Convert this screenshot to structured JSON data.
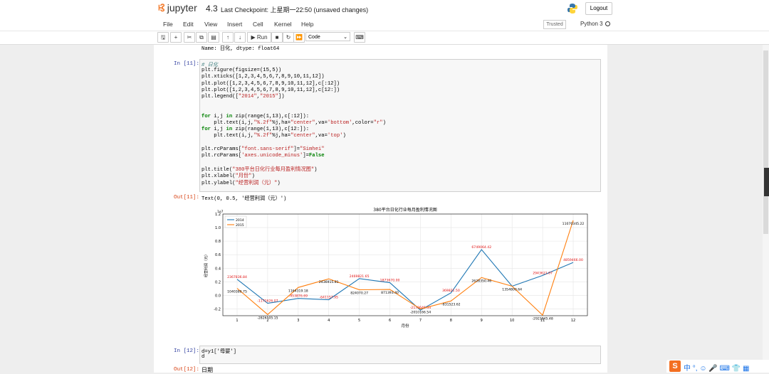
{
  "header": {
    "app_name": "jupyter",
    "notebook_name": "4.3",
    "checkpoint": "Last Checkpoint: 上星期一22:50  (unsaved changes)",
    "logout_label": "Logout"
  },
  "menu": [
    "File",
    "Edit",
    "View",
    "Insert",
    "Cell",
    "Kernel",
    "Help"
  ],
  "trusted_label": "Trusted",
  "kernel_label": "Python 3",
  "toolbar": {
    "run_label": "Run",
    "cell_type": "Code"
  },
  "cells": {
    "prev_output": "Name: 日化, dtype: float64",
    "cell11_prompt": "In [11]:",
    "cell11_lines": [
      "# 日化",
      "plt.figure(figsize=(15,5))",
      "plt.xticks([1,2,3,4,5,6,7,8,9,10,11,12])",
      "plt.plot([1,2,3,4,5,6,7,8,9,10,11,12],c[:12])",
      "plt.plot([1,2,3,4,5,6,7,8,9,10,11,12],c[12:])",
      "plt.legend([\"2014\",\"2015\"])",
      "",
      "",
      "for i,j in zip(range(1,13),c[:12]):",
      "    plt.text(i,j,\"%.2f\"%j,ha=\"center\",va='bottom',color=\"r\")",
      "for i,j in zip(range(1,13),c[12:]):",
      "    plt.text(i,j,\"%.2f\"%j,ha=\"center\",va='top')",
      "",
      "plt.rcParams[\"font.sans-serif\"]=\"Simhei\"",
      "plt.rcParams['axes.unicode_minus']=False",
      "",
      "plt.title(\"380平台日化行业每月盈利情况图\")",
      "plt.xlabel(\"月份\")",
      "plt.ylabel(\"经营利润（元）\")"
    ],
    "out11_prompt": "Out[11]:",
    "out11_text": "Text(0, 0.5, '经营利润（元）')",
    "cell12_prompt": "In [12]:",
    "cell12_lines": [
      "d=y1['母婴']",
      "d"
    ],
    "out12_prompt": "Out[12]:",
    "out12_text": "日期"
  },
  "chart_data": {
    "type": "line",
    "title": "380平台日化行业每月盈利情况图",
    "xlabel": "月份",
    "ylabel": "经营利润（元）",
    "y_scale_label": "1e7",
    "x": [
      1,
      2,
      3,
      4,
      5,
      6,
      7,
      8,
      9,
      10,
      11,
      12
    ],
    "ylim": [
      -0.3,
      1.2
    ],
    "yticks": [
      -0.2,
      0.0,
      0.2,
      0.4,
      0.6,
      0.8,
      1.0,
      1.2
    ],
    "series": [
      {
        "name": "2014",
        "color": "#1f77b4",
        "values": [
          2367836.84,
          -1171626.07,
          -453876.69,
          -641157.95,
          2469821.65,
          1873670.0,
          -2178646.34,
          369821.5,
          6749064.42,
          1354800.64,
          2943621.07,
          4859466.0
        ],
        "labels": [
          "2367836.84",
          "-1171626.07",
          "-453876.69",
          "-641157.95",
          "2469821.65",
          "1873670.00",
          "-2178646.34",
          "369821.50",
          "6749064.42",
          "",
          "2943621.07",
          "4859466.00"
        ]
      },
      {
        "name": "2015",
        "color": "#ff7f0e",
        "values": [
          1040380.75,
          -2826505.15,
          1164319.18,
          2436915.81,
          824070.27,
          871393.4,
          -2010166.54,
          -831523.62,
          2628350.46,
          1354800.64,
          -2923845.48,
          11070345.22
        ],
        "labels": [
          "1040380.75",
          "-2826505.15",
          "1164319.18",
          "2436915.81",
          "824070.27",
          "871393.40",
          "-2010166.54",
          "-831523.62",
          "2628350.46",
          "1354800.64",
          "-2923845.48",
          "11070345.22"
        ]
      }
    ],
    "legend_position": "top-left",
    "grid": true
  }
}
